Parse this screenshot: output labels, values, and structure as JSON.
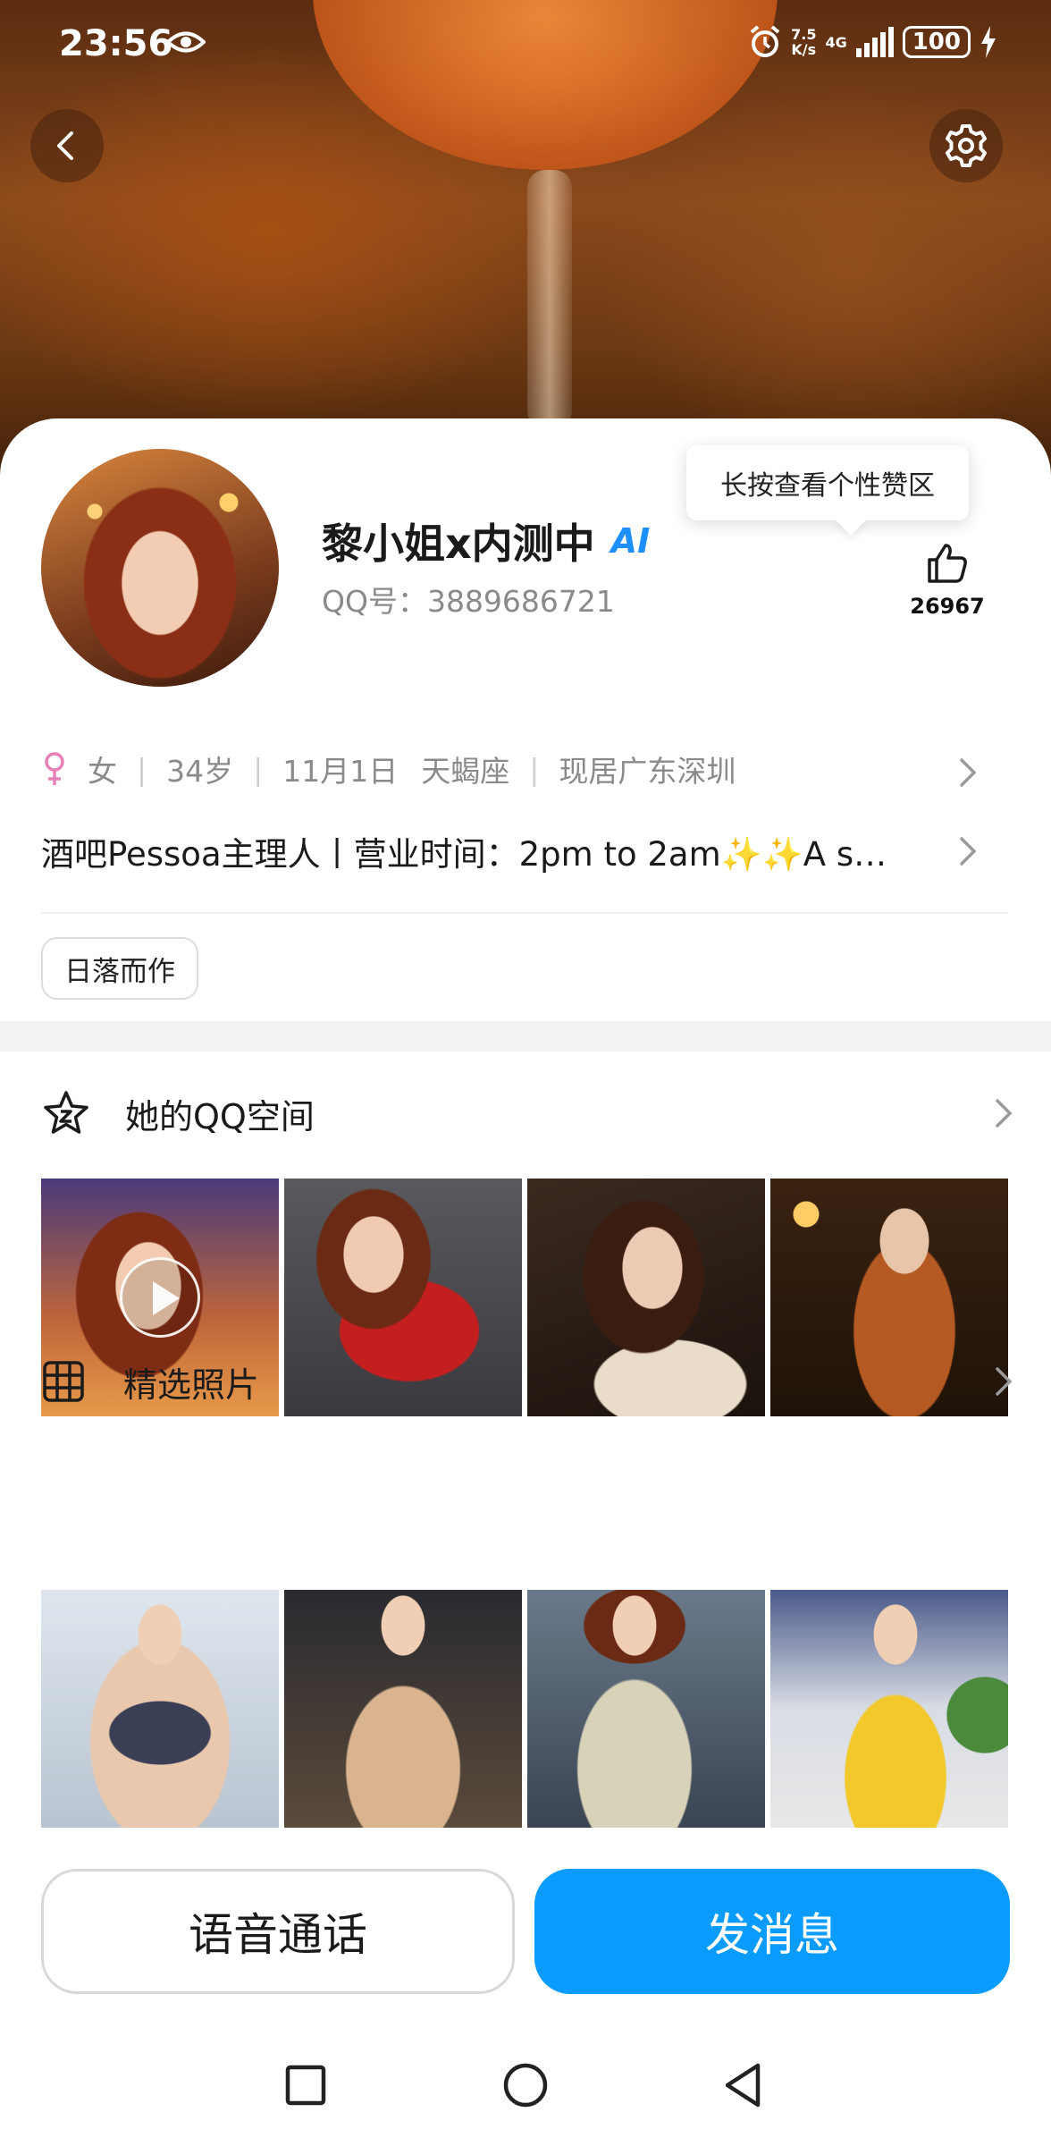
{
  "status_bar": {
    "time": "23:56",
    "net_speed_value": "7.5",
    "net_speed_unit": "K/s",
    "network_type": "4G",
    "battery": "100"
  },
  "profile": {
    "name": "黎小姐x内测中",
    "ai_badge": "AI",
    "qq_number": "QQ号：3889686721",
    "like_tooltip": "长按查看个性赞区",
    "like_count": "26967",
    "gender": "女",
    "age": "34岁",
    "birthday": "11月1日",
    "zodiac": "天蝎座",
    "location": "现居广东深圳",
    "bio_main": "酒吧Pessoa主理人丨营业时间：2pm to 2am",
    "bio_sparkles": "✨✨",
    "bio_tail": "A s…",
    "tag": "日落而作"
  },
  "sections": {
    "qzone": {
      "title": "她的QQ空间"
    },
    "photos": {
      "title": "精选照片"
    }
  },
  "actions": {
    "voice_call": "语音通话",
    "send_message": "发消息"
  },
  "colors": {
    "accent_blue": "#0a9bff",
    "ai_blue": "#1e8fff",
    "gender_pink": "#e880b8"
  }
}
